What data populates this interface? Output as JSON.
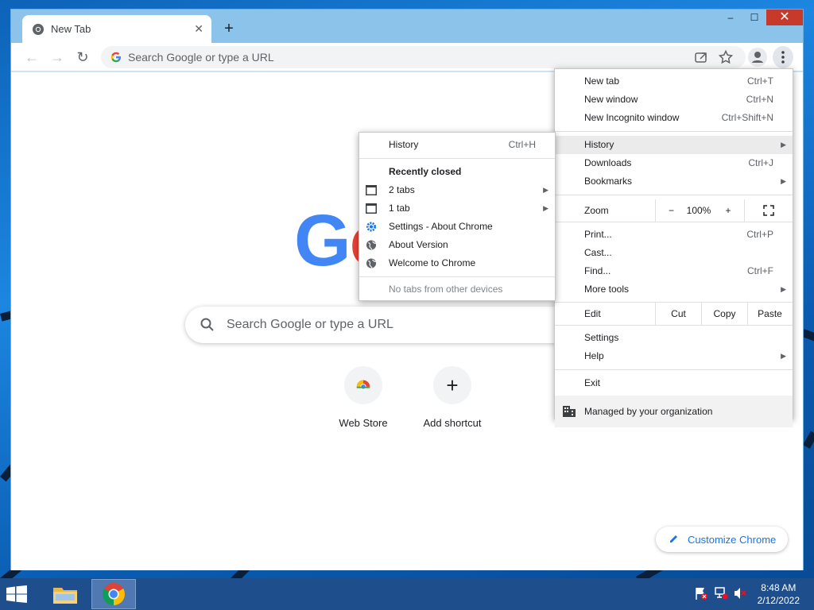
{
  "browser": {
    "tab_title": "New Tab",
    "tab_close": "✕",
    "new_tab": "+",
    "omnibox_placeholder": "Search Google or type a URL",
    "window_controls": {
      "minimize": "–",
      "maximize": "☐",
      "close": "✕"
    }
  },
  "ntp": {
    "logo_g": "G",
    "logo_o": "o",
    "search_placeholder": "Search Google or type a URL",
    "shortcuts": [
      {
        "label": "Web Store"
      },
      {
        "label": "Add shortcut",
        "glyph": "+"
      }
    ],
    "customize_label": "Customize Chrome"
  },
  "main_menu": {
    "new_tab": {
      "label": "New tab",
      "shortcut": "Ctrl+T"
    },
    "new_window": {
      "label": "New window",
      "shortcut": "Ctrl+N"
    },
    "new_incognito": {
      "label": "New Incognito window",
      "shortcut": "Ctrl+Shift+N"
    },
    "history": {
      "label": "History"
    },
    "downloads": {
      "label": "Downloads",
      "shortcut": "Ctrl+J"
    },
    "bookmarks": {
      "label": "Bookmarks"
    },
    "zoom": {
      "label": "Zoom",
      "minus": "−",
      "value": "100%",
      "plus": "+"
    },
    "print": {
      "label": "Print...",
      "shortcut": "Ctrl+P"
    },
    "cast": {
      "label": "Cast..."
    },
    "find": {
      "label": "Find...",
      "shortcut": "Ctrl+F"
    },
    "more_tools": {
      "label": "More tools"
    },
    "edit": {
      "label": "Edit",
      "cut": "Cut",
      "copy": "Copy",
      "paste": "Paste"
    },
    "settings": {
      "label": "Settings"
    },
    "help": {
      "label": "Help"
    },
    "exit": {
      "label": "Exit"
    },
    "managed": {
      "label": "Managed by your organization"
    }
  },
  "history_menu": {
    "history": {
      "label": "History",
      "shortcut": "Ctrl+H"
    },
    "recently_closed": "Recently closed",
    "items": [
      {
        "label": "2 tabs",
        "icon": "window-icon",
        "submenu": true
      },
      {
        "label": "1 tab",
        "icon": "window-icon",
        "submenu": true
      },
      {
        "label": "Settings - About Chrome",
        "icon": "gear-icon"
      },
      {
        "label": "About Version",
        "icon": "globe-icon"
      },
      {
        "label": "Welcome to Chrome",
        "icon": "globe-icon"
      }
    ],
    "no_devices": "No tabs from other devices"
  },
  "taskbar": {
    "clock_time": "8:48 AM",
    "clock_date": "2/12/2022"
  }
}
